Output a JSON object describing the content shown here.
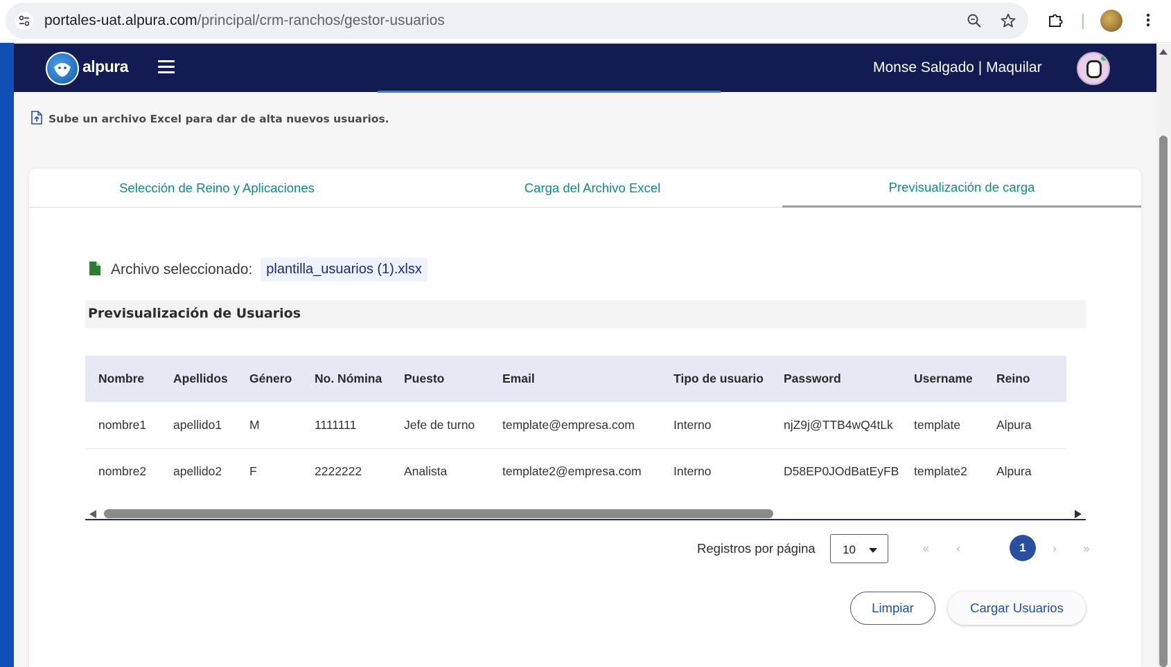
{
  "browser": {
    "url_host": "portales-uat.alpura.com",
    "url_path": "/principal/crm-ranchos/gestor-usuarios",
    "icons": [
      "site-settings-icon",
      "zoom-icon",
      "bookmark-star-icon",
      "extensions-icon",
      "profile-avatar",
      "more-menu-icon"
    ]
  },
  "header": {
    "logo_text": "alpura",
    "user_label": "Monse Salgado | Maquilar",
    "background": "#131c52"
  },
  "upload_note": "Sube un archivo Excel para dar de alta nuevos usuarios.",
  "tabs": [
    {
      "label": "Selección de Reino y Aplicaciones",
      "active": false
    },
    {
      "label": "Carga del Archivo Excel",
      "active": false
    },
    {
      "label": "Previsualización de carga",
      "active": true
    }
  ],
  "file": {
    "label": "Archivo seleccionado:",
    "name": "plantilla_usuarios (1).xlsx"
  },
  "preview_title": "Previsualización de Usuarios",
  "table": {
    "columns": [
      "Nombre",
      "Apellidos",
      "Género",
      "No. Nómina",
      "Puesto",
      "Email",
      "Tipo de usuario",
      "Password",
      "Username",
      "Reino"
    ],
    "rows": [
      [
        "nombre1",
        "apellido1",
        "M",
        "1111111",
        "Jefe de turno",
        "template@empresa.com",
        "Interno",
        "njZ9j@TTB4wQ4tLk",
        "template",
        "Alpura"
      ],
      [
        "nombre2",
        "apellido2",
        "F",
        "2222222",
        "Analista",
        "template2@empresa.com",
        "Interno",
        "D58EP0JOdBatEyFB",
        "template2",
        "Alpura"
      ]
    ]
  },
  "paginator": {
    "label": "Registros por página",
    "page_size": "10",
    "current_page": "1",
    "first": "«",
    "prev": "‹",
    "next": "›",
    "last": "»"
  },
  "actions": {
    "clear_label": "Limpiar",
    "load_label": "Cargar Usuarios"
  },
  "colors": {
    "accent_teal": "#0f8a87",
    "primary_blue": "#1e4ea8",
    "page_active": "#2a4f9e"
  }
}
